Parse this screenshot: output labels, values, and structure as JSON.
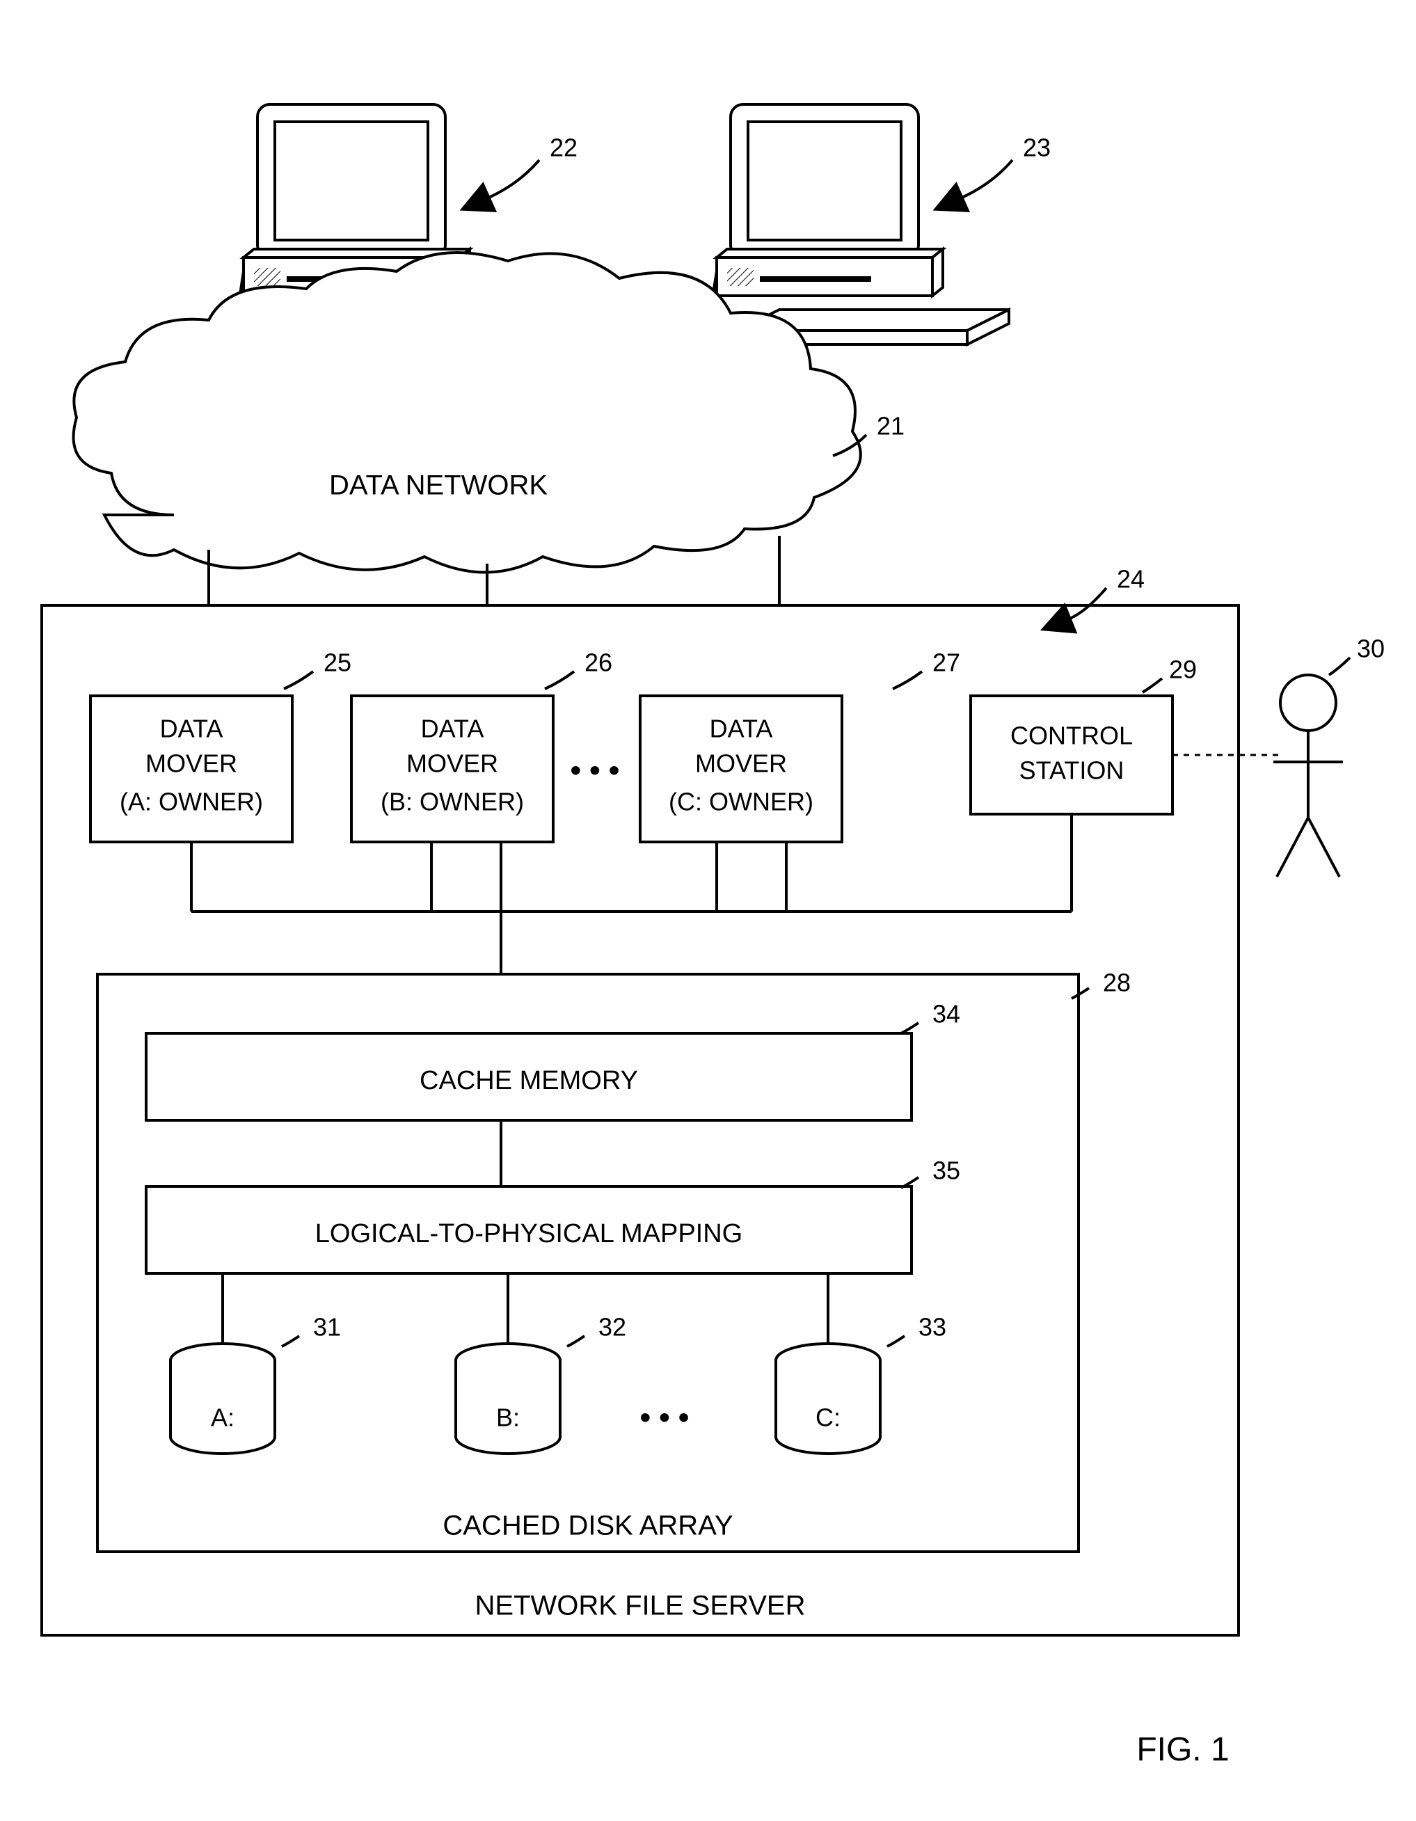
{
  "labels": {
    "ref22": "22",
    "ref23": "23",
    "ref21": "21",
    "ref24": "24",
    "ref25": "25",
    "ref26": "26",
    "ref27": "27",
    "ref29": "29",
    "ref30": "30",
    "ref28": "28",
    "ref34": "34",
    "ref35": "35",
    "ref31": "31",
    "ref32": "32",
    "ref33": "33",
    "data_network": "DATA NETWORK",
    "dm25_l1": "DATA",
    "dm25_l2": "MOVER",
    "dm25_l3": "(A: OWNER)",
    "dm26_l1": "DATA",
    "dm26_l2": "MOVER",
    "dm26_l3": "(B: OWNER)",
    "dm27_l1": "DATA",
    "dm27_l2": "MOVER",
    "dm27_l3": "(C: OWNER)",
    "cs_l1": "CONTROL",
    "cs_l2": "STATION",
    "cache": "CACHE MEMORY",
    "mapping": "LOGICAL-TO-PHYSICAL MAPPING",
    "diskA": "A:",
    "diskB": "B:",
    "diskC": "C:",
    "cda": "CACHED DISK ARRAY",
    "nfs": "NETWORK FILE SERVER",
    "dots": "• • •",
    "fig": "FIG. 1"
  }
}
